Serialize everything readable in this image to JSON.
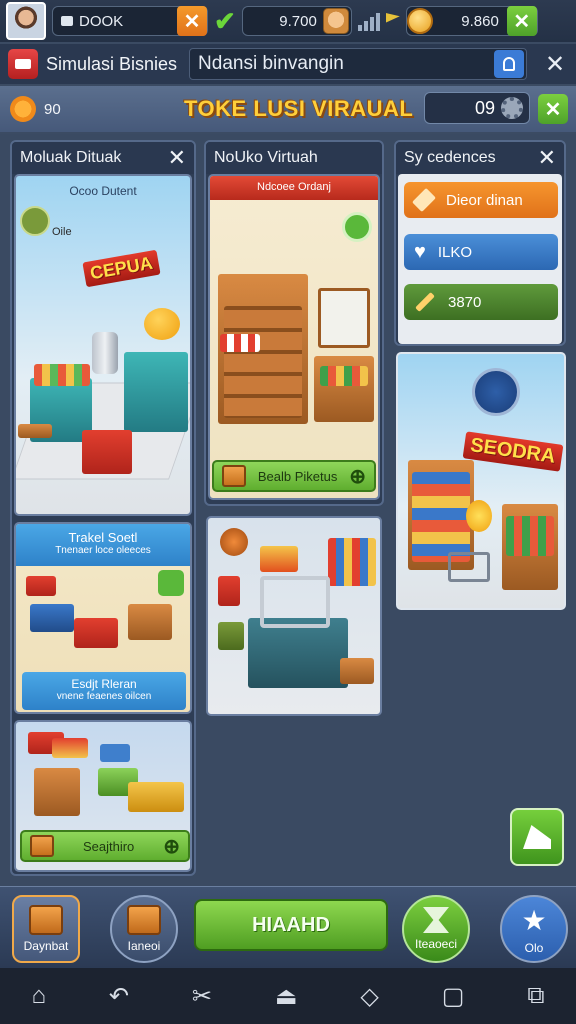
{
  "status": {
    "search_text": "DOOK",
    "value_mid": "9.700",
    "value_right": "9.860"
  },
  "appbar": {
    "title": "Simulasi Bisnies",
    "search_value": "Ndansi binvangin"
  },
  "titlerow": {
    "left_value": "90",
    "game_title": "TOKE LUSI VIRAUAL",
    "counter": "09"
  },
  "panels": {
    "left_title": "Moluak Dituak",
    "left_card1_caption": "Ocoo Dutent",
    "left_card1_small": "Oile",
    "left_card1_sign": "CEPUA",
    "left_card2_title": "Trakel Soetl",
    "left_card2_sub": "Tnenaer loce oleeces",
    "left_card2_btn": "Esdjt Rleran",
    "left_card2_btn_sub": "vnene feaenes oilcen",
    "left_card3_action": "Seajthiro",
    "mid_title": "NoUko Virtuah",
    "mid_card1_banner": "Ndcoee Ordanj",
    "mid_card1_action": "Bealb Piketus",
    "right_title": "Sy cedences",
    "right_menu": [
      "Dieor dinan",
      "ILKO",
      "3870"
    ],
    "right_card_sign": "SEODRA"
  },
  "bottomnav": {
    "item1": "Daynbat",
    "item2": "Ianeoi",
    "center_btn": "HIAAHD",
    "item4": "Iteaoeci",
    "item5": "Olo"
  }
}
